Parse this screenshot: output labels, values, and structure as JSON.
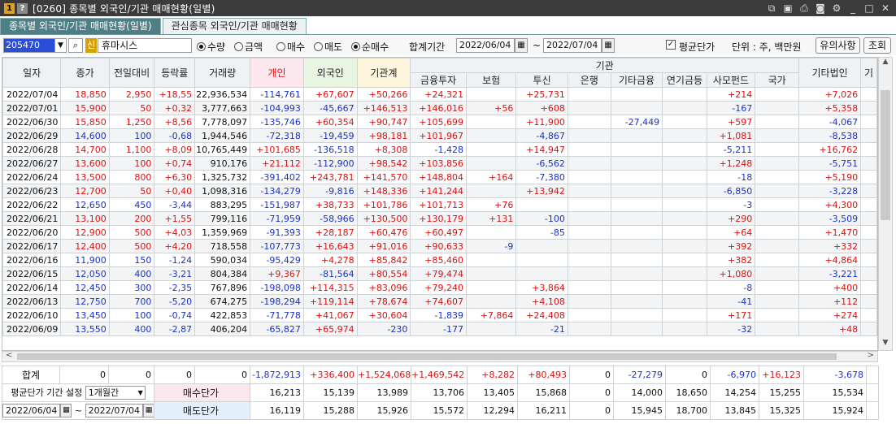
{
  "window": {
    "title": "[0260] 종목별 외국인/기관 매매현황(일별)",
    "badge_num": "1",
    "badge_help": "?"
  },
  "tabs": [
    {
      "label": "종목별 외국인/기관 매매현황(일별)",
      "active": true
    },
    {
      "label": "관심종목 외국인/기관 매매현황",
      "active": false
    }
  ],
  "toolbar": {
    "code": "205470",
    "shin": "신",
    "name": "휴마시스",
    "unit_options": [
      {
        "label": "수량",
        "checked": true
      },
      {
        "label": "금액",
        "checked": false
      }
    ],
    "side_options": [
      {
        "label": "매수",
        "checked": false
      },
      {
        "label": "매도",
        "checked": false
      },
      {
        "label": "순매수",
        "checked": true
      }
    ],
    "period_label": "합계기간",
    "date_from": "2022/06/04",
    "tilde": "~",
    "date_to": "2022/07/04",
    "avg_price_label": "평균단가",
    "avg_price_checked": true,
    "unit_label": "단위 : 주, 백만원",
    "notice_button": "유의사항",
    "query_button": "조회"
  },
  "grid": {
    "group_header": "기관",
    "columns": [
      "일자",
      "종가",
      "전일대비",
      "등락률",
      "거래량",
      "개인",
      "외국인",
      "기관계",
      "금융투자",
      "보험",
      "투신",
      "은행",
      "기타금융",
      "연기금등",
      "사모펀드",
      "국가",
      "기타법인",
      "기"
    ],
    "rows": [
      [
        "2022/07/04",
        "18,850",
        "2,950",
        "+18,55",
        "22,936,534",
        "-114,761",
        "+67,607",
        "+50,266",
        "+24,321",
        "",
        "+25,731",
        "",
        "",
        "",
        "+214",
        "",
        "+7,026"
      ],
      [
        "2022/07/01",
        "15,900",
        "50",
        "+0,32",
        "3,777,663",
        "-104,993",
        "-45,667",
        "+146,513",
        "+146,016",
        "+56",
        "+608",
        "",
        "",
        "",
        "-167",
        "",
        "+5,358"
      ],
      [
        "2022/06/30",
        "15,850",
        "1,250",
        "+8,56",
        "7,778,097",
        "-135,746",
        "+60,354",
        "+90,747",
        "+105,699",
        "",
        "+11,900",
        "",
        "-27,449",
        "",
        "+597",
        "",
        "-4,067"
      ],
      [
        "2022/06/29",
        "14,600",
        "100",
        "-0,68",
        "1,944,546",
        "-72,318",
        "-19,459",
        "+98,181",
        "+101,967",
        "",
        "-4,867",
        "",
        "",
        "",
        "+1,081",
        "",
        "-8,538"
      ],
      [
        "2022/06/28",
        "14,700",
        "1,100",
        "+8,09",
        "10,765,449",
        "+101,685",
        "-136,518",
        "+8,308",
        "-1,428",
        "",
        "+14,947",
        "",
        "",
        "",
        "-5,211",
        "",
        "+16,762"
      ],
      [
        "2022/06/27",
        "13,600",
        "100",
        "+0,74",
        "910,176",
        "+21,112",
        "-112,900",
        "+98,542",
        "+103,856",
        "",
        "-6,562",
        "",
        "",
        "",
        "+1,248",
        "",
        "-5,751"
      ],
      [
        "2022/06/24",
        "13,500",
        "800",
        "+6,30",
        "1,325,732",
        "-391,402",
        "+243,781",
        "+141,570",
        "+148,804",
        "+164",
        "-7,380",
        "",
        "",
        "",
        "-18",
        "",
        "+5,190"
      ],
      [
        "2022/06/23",
        "12,700",
        "50",
        "+0,40",
        "1,098,316",
        "-134,279",
        "-9,816",
        "+148,336",
        "+141,244",
        "",
        "+13,942",
        "",
        "",
        "",
        "-6,850",
        "",
        "-3,228"
      ],
      [
        "2022/06/22",
        "12,650",
        "450",
        "-3,44",
        "883,295",
        "-151,987",
        "+38,733",
        "+101,786",
        "+101,713",
        "+76",
        "",
        "",
        "",
        "",
        "-3",
        "",
        "+4,300"
      ],
      [
        "2022/06/21",
        "13,100",
        "200",
        "+1,55",
        "799,116",
        "-71,959",
        "-58,966",
        "+130,500",
        "+130,179",
        "+131",
        "-100",
        "",
        "",
        "",
        "+290",
        "",
        "-3,509"
      ],
      [
        "2022/06/20",
        "12,900",
        "500",
        "+4,03",
        "1,359,969",
        "-91,393",
        "+28,187",
        "+60,476",
        "+60,497",
        "",
        "-85",
        "",
        "",
        "",
        "+64",
        "",
        "+1,470"
      ],
      [
        "2022/06/17",
        "12,400",
        "500",
        "+4,20",
        "718,558",
        "-107,773",
        "+16,643",
        "+91,016",
        "+90,633",
        "-9",
        "",
        "",
        "",
        "",
        "+392",
        "",
        "+332"
      ],
      [
        "2022/06/16",
        "11,900",
        "150",
        "-1,24",
        "590,034",
        "-95,429",
        "+4,278",
        "+85,842",
        "+85,460",
        "",
        "",
        "",
        "",
        "",
        "+382",
        "",
        "+4,864"
      ],
      [
        "2022/06/15",
        "12,050",
        "400",
        "-3,21",
        "804,384",
        "+9,367",
        "-81,564",
        "+80,554",
        "+79,474",
        "",
        "",
        "",
        "",
        "",
        "+1,080",
        "",
        "-3,221"
      ],
      [
        "2022/06/14",
        "12,450",
        "300",
        "-2,35",
        "767,896",
        "-198,098",
        "+114,315",
        "+83,096",
        "+79,240",
        "",
        "+3,864",
        "",
        "",
        "",
        "-8",
        "",
        "+400"
      ],
      [
        "2022/06/13",
        "12,750",
        "700",
        "-5,20",
        "674,275",
        "-198,294",
        "+119,114",
        "+78,674",
        "+74,607",
        "",
        "+4,108",
        "",
        "",
        "",
        "-41",
        "",
        "+112"
      ],
      [
        "2022/06/10",
        "13,450",
        "100",
        "-0,74",
        "422,853",
        "-71,778",
        "+41,067",
        "+30,604",
        "-1,839",
        "+7,864",
        "+24,408",
        "",
        "",
        "",
        "+171",
        "",
        "+274"
      ],
      [
        "2022/06/09",
        "13,550",
        "400",
        "-2,87",
        "406,204",
        "-65,827",
        "+65,974",
        "-230",
        "-177",
        "",
        "-21",
        "",
        "",
        "",
        "-32",
        "",
        "+48"
      ]
    ],
    "row_colors": [
      "red",
      "red",
      "red",
      "blue",
      "red",
      "red",
      "red",
      "red",
      "blue",
      "red",
      "red",
      "red",
      "blue",
      "blue",
      "blue",
      "blue",
      "blue",
      "blue"
    ]
  },
  "footer": {
    "sum_label": "합계",
    "sum": [
      "0",
      "0",
      "0",
      "0",
      "-1,872,913",
      "+336,400",
      "+1,524,068",
      "+1,469,542",
      "+8,282",
      "+80,493",
      "0",
      "-27,279",
      "0",
      "-6,970",
      "+16,123",
      "-3,678"
    ],
    "avg_period_label": "평균단가 기간 설정",
    "avg_period_value": "1개월간",
    "buy_label": "매수단가",
    "buy": [
      "16,213",
      "15,139",
      "13,989",
      "13,706",
      "13,405",
      "15,868",
      "0",
      "14,000",
      "18,650",
      "14,254",
      "15,255",
      "15,534"
    ],
    "sell_label": "매도단가",
    "sell": [
      "16,119",
      "15,288",
      "15,926",
      "15,572",
      "12,294",
      "16,211",
      "0",
      "15,945",
      "18,700",
      "13,845",
      "15,325",
      "15,924"
    ],
    "date_from": "2022/06/04",
    "date_to": "2022/07/04",
    "tilde": "~"
  }
}
